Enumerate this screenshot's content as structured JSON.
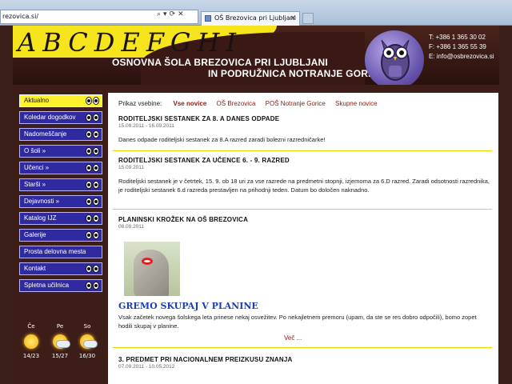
{
  "browser": {
    "address": "rezovica.si/",
    "tab_title": "OŠ Brezovica pri Ljubljani",
    "tab_close": "×"
  },
  "header": {
    "logo_letters": "ABCDEFGHI",
    "school_line1": "OSNOVNA ŠOLA BREZOVICA PRI LJUBLJANI",
    "school_line2": "IN PODRUŽNICA NOTRANJE GORICE",
    "contact_phone": "T: +386 1 365 30 02",
    "contact_fax": "F: +386 1 365 55 39",
    "contact_email": "E: info@osbrezovica.si"
  },
  "sidebar": {
    "items": [
      {
        "label": "Aktualno",
        "active": true
      },
      {
        "label": "Koledar dogodkov"
      },
      {
        "label": "Nadomeščanje"
      },
      {
        "label": "O šoli »"
      },
      {
        "label": "Učenci »"
      },
      {
        "label": "Starši »"
      },
      {
        "label": "Dejavnosti »"
      },
      {
        "label": "Katalog IJZ"
      },
      {
        "label": "Galerije"
      },
      {
        "label": "Prosta delovna mesta"
      },
      {
        "label": "Kontakt"
      },
      {
        "label": "Spletna učilnica"
      }
    ]
  },
  "weather": [
    {
      "day": "Če",
      "temp": "14/23",
      "icon": "sun-icon"
    },
    {
      "day": "Pe",
      "temp": "15/27",
      "icon": "sun-cloud-icon"
    },
    {
      "day": "So",
      "temp": "16/30",
      "icon": "sun-cloud-icon"
    }
  ],
  "filter": {
    "label": "Prikaz vsebine:",
    "options": [
      "Vse novice",
      "OŠ Brezovica",
      "POŠ Notranje Gorice",
      "Skupne novice"
    ]
  },
  "news": [
    {
      "title": "RODITELJSKI SESTANEK ZA 8. A DANES ODPADE",
      "date": "15.09.2011 - 16.09.2011",
      "body": "Danes odpade roditeljski sestanek za 8.A razred zaradi bolezni razredničarke!"
    },
    {
      "title": "RODITELJSKI SESTANEK ZA UČENCE 6. - 9. RAZRED",
      "date": "15.09.2011",
      "body": "Roditeljski sestanek je v četrtek, 15. 9. ob 18 uri za vse razrede na predmetni stopnji, izjemoma za 6.D razred. Zaradi odsotnosti razrednika, je roditeljski sestanek 6.d razreda prestavljen na prihodnji teden. Datum bo določen naknadno."
    },
    {
      "title": "PLANINSKI KROŽEK NA OŠ BREZOVICA",
      "date": "08.09.2011",
      "headline": "GREMO SKUPAJ V PLANINE",
      "body": "Vsak začetek novega šolskega leta prinese nekaj osvežitev. Po nekajletnem premoru (upam, da ste se res dobro odpočili), bomo zopet hodili skupaj v planine.",
      "more": "Več ..."
    },
    {
      "title": "3. PREDMET PRI NACIONALNEM PREIZKUSU ZNANJA",
      "date": "07.09.2011 - 10.05.2012"
    }
  ],
  "colors": {
    "accent_yellow": "#fff12a",
    "nav_blue": "#2f2aa0",
    "header_brown": "#3d1d17",
    "link_red": "#8a1e14",
    "headline_blue": "#1b3dbd"
  }
}
